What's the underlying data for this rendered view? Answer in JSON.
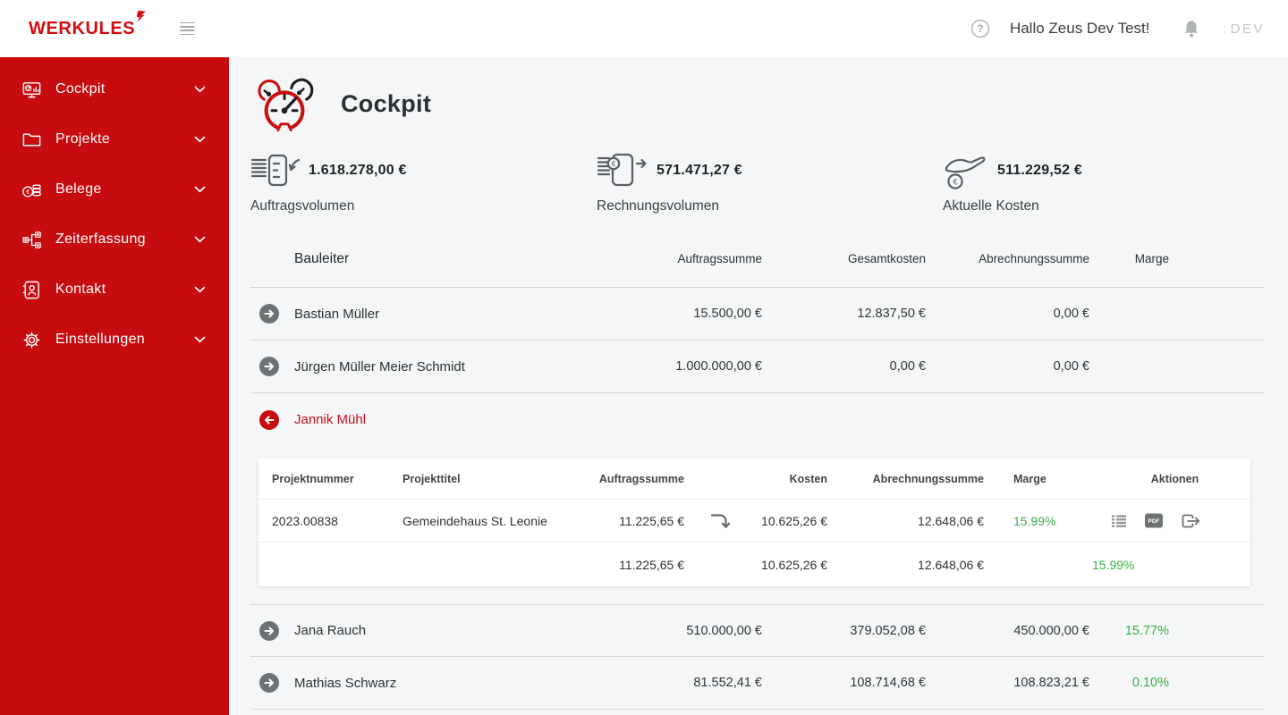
{
  "topbar": {
    "logo": "WERKULES",
    "greeting": "Hallo Zeus Dev Test!",
    "env_fragment": ":",
    "env_label": "DEV",
    "icons": [
      "help-icon",
      "bell-icon",
      "menu-icon"
    ]
  },
  "sidebar": {
    "items": [
      {
        "label": "Cockpit",
        "icon": "dashboard-monitor-icon"
      },
      {
        "label": "Projekte",
        "icon": "folder-icon"
      },
      {
        "label": "Belege",
        "icon": "coins-icon"
      },
      {
        "label": "Zeiterfassung",
        "icon": "org-time-icon"
      },
      {
        "label": "Kontakt",
        "icon": "contact-book-icon"
      },
      {
        "label": "Einstellungen",
        "icon": "gear-icon"
      }
    ]
  },
  "page": {
    "title": "Cockpit",
    "title_icon": "speedometer-icon"
  },
  "stats": [
    {
      "icon": "order-volume-icon",
      "value": "1.618.278,00 €",
      "label": "Auftragsvolumen"
    },
    {
      "icon": "invoice-volume-icon",
      "value": "571.471,27 €",
      "label": "Rechnungsvolumen"
    },
    {
      "icon": "current-costs-icon",
      "value": "511.229,52 €",
      "label": "Aktuelle Kosten"
    }
  ],
  "table": {
    "headers": {
      "bauleiter": "Bauleiter",
      "auftragssumme": "Auftragssumme",
      "gesamtkosten": "Gesamtkosten",
      "abrechnungssumme": "Abrechnungssumme",
      "marge": "Marge"
    },
    "rows": [
      {
        "name": "Bastian Müller",
        "auftragssumme": "15.500,00 €",
        "gesamtkosten": "12.837,50 €",
        "abrechnungssumme": "0,00 €",
        "marge": "",
        "expanded": false
      },
      {
        "name": "Jürgen Müller Meier Schmidt",
        "auftragssumme": "1.000.000,00 €",
        "gesamtkosten": "0,00 €",
        "abrechnungssumme": "0,00 €",
        "marge": "",
        "expanded": false
      },
      {
        "name": "Jannik Mühl",
        "auftragssumme": "",
        "gesamtkosten": "",
        "abrechnungssumme": "",
        "marge": "",
        "expanded": true
      },
      {
        "name": "Jana Rauch",
        "auftragssumme": "510.000,00 €",
        "gesamtkosten": "379.052,08 €",
        "abrechnungssumme": "450.000,00 €",
        "marge": "15.77%",
        "expanded": false
      },
      {
        "name": "Mathias Schwarz",
        "auftragssumme": "81.552,41 €",
        "gesamtkosten": "108.714,68 €",
        "abrechnungssumme": "108.823,21 €",
        "marge": "0.10%",
        "expanded": false
      }
    ]
  },
  "project_table": {
    "headers": {
      "projektnummer": "Projektnummer",
      "projekttitel": "Projekttitel",
      "auftragssumme": "Auftragssumme",
      "kosten": "Kosten",
      "abrechnungssumme": "Abrechnungssumme",
      "marge": "Marge",
      "aktionen": "Aktionen"
    },
    "rows": [
      {
        "projektnummer": "2023.00838",
        "projekttitel": "Gemeindehaus St. Leonie",
        "auftragssumme": "11.225,65 €",
        "kosten": "10.625,26 €",
        "abrechnungssumme": "12.648,06 €",
        "marge": "15.99%",
        "aktionen": [
          "list-icon",
          "pdf-icon",
          "export-icon"
        ]
      }
    ],
    "totals": {
      "auftragssumme": "11.225,65 €",
      "kosten": "10.625,26 €",
      "abrechnungssumme": "12.648,06 €",
      "marge": "15.99%"
    }
  },
  "colors": {
    "brand_red": "#d40d12",
    "sidebar_red": "#c70c10",
    "active_row_red": "#cc1016",
    "marge_green": "#3bae47",
    "icon_gray": "#6d7276",
    "content_bg": "#f4f6f8"
  }
}
